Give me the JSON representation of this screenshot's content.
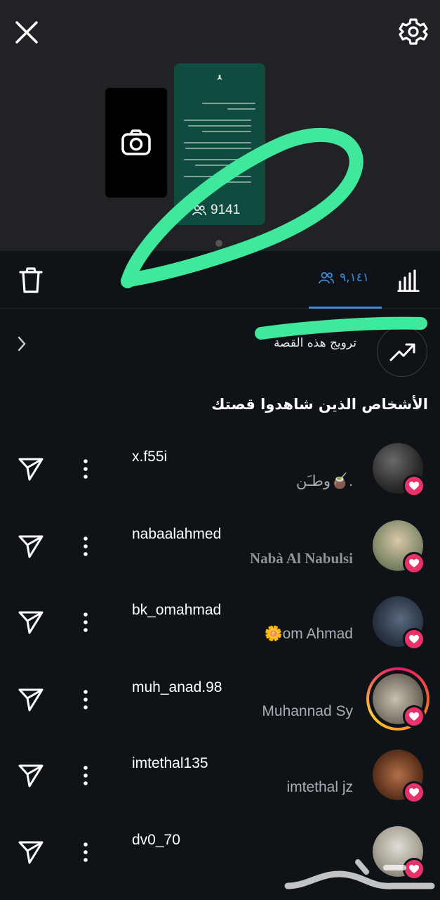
{
  "story": {
    "viewer_count_latin": "9141",
    "viewer_count_arabic": "٩,١٤١"
  },
  "promote": {
    "label": "ترويج هذه القصة"
  },
  "section_title": "الأشخاص الذين شاهدوا قصتك",
  "viewers": [
    {
      "username": "x.f55i",
      "full_name": "وطـَن🧉."
    },
    {
      "username": "nabaalahmed",
      "full_name": "Nabà Al Nabulsi"
    },
    {
      "username": "bk_omahmad",
      "full_name": "🌼om Ahmad"
    },
    {
      "username": "muh_anad.98",
      "full_name": "Muhannad Sy"
    },
    {
      "username": "imtethal135",
      "full_name": "imtethal jz"
    },
    {
      "username": "dv0_70",
      "full_name": ""
    }
  ],
  "watermark": {
    "text": "حراج"
  },
  "colors": {
    "accent": "#3f8bd9",
    "heart": "#e8326a",
    "scribble": "#3fe89a",
    "background": "#0f1217"
  },
  "icons": [
    "close-icon",
    "gear-icon",
    "camera-icon",
    "trash-icon",
    "people-icon",
    "bar-chart-icon",
    "chevron-left-icon",
    "trending-up-icon",
    "send-icon",
    "more-vertical-icon",
    "heart-icon"
  ]
}
